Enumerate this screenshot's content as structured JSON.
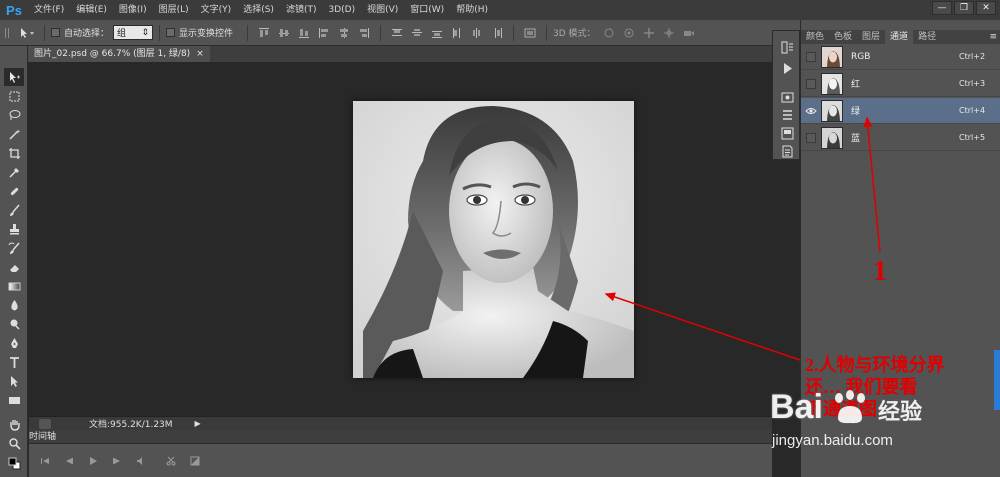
{
  "app": {
    "logo": "Ps"
  },
  "menu": [
    "文件(F)",
    "编辑(E)",
    "图像(I)",
    "图层(L)",
    "文字(Y)",
    "选择(S)",
    "滤镜(T)",
    "3D(D)",
    "视图(V)",
    "窗口(W)",
    "帮助(H)"
  ],
  "window_buttons": {
    "minimize": "—",
    "restore": "❐",
    "close": "✕"
  },
  "options": {
    "auto_select_label": "自动选择：",
    "auto_select_value": "组",
    "show_transform_label": "显示变换控件",
    "mode_3d_label": "3D 模式："
  },
  "document": {
    "tab_title": "图片_02.psd @ 66.7% (图层 1, 绿/8)",
    "tab_close": "×"
  },
  "status": {
    "doc_info": "文档:955.2K/1.23M",
    "arrow": "▶"
  },
  "timeline": {
    "label": "时间轴"
  },
  "panel": {
    "tabs": [
      "颜色",
      "色板",
      "图层",
      "通道",
      "路径"
    ],
    "active_tab": "通道",
    "menu_icon": "≡",
    "channels": [
      {
        "name": "RGB",
        "shortcut": "Ctrl+2",
        "visible": false,
        "selected": false
      },
      {
        "name": "红",
        "shortcut": "Ctrl+3",
        "visible": false,
        "selected": false
      },
      {
        "name": "绿",
        "shortcut": "Ctrl+4",
        "visible": true,
        "selected": true
      },
      {
        "name": "蓝",
        "shortcut": "Ctrl+5",
        "visible": false,
        "selected": false
      }
    ]
  },
  "annotations": {
    "label_1": "1",
    "label_2_line1": "2.人物与环境分界",
    "label_2_line2": "还… 我们要看",
    "label_2_line3": "下通道图"
  },
  "watermark": {
    "brand": "Bai",
    "brand_sub": "经验",
    "url": "jingyan.baidu.com"
  },
  "colors": {
    "accent_selected": "#5c6f8a",
    "annotation_red": "#e00000",
    "ps_blue": "#36a3f4"
  }
}
